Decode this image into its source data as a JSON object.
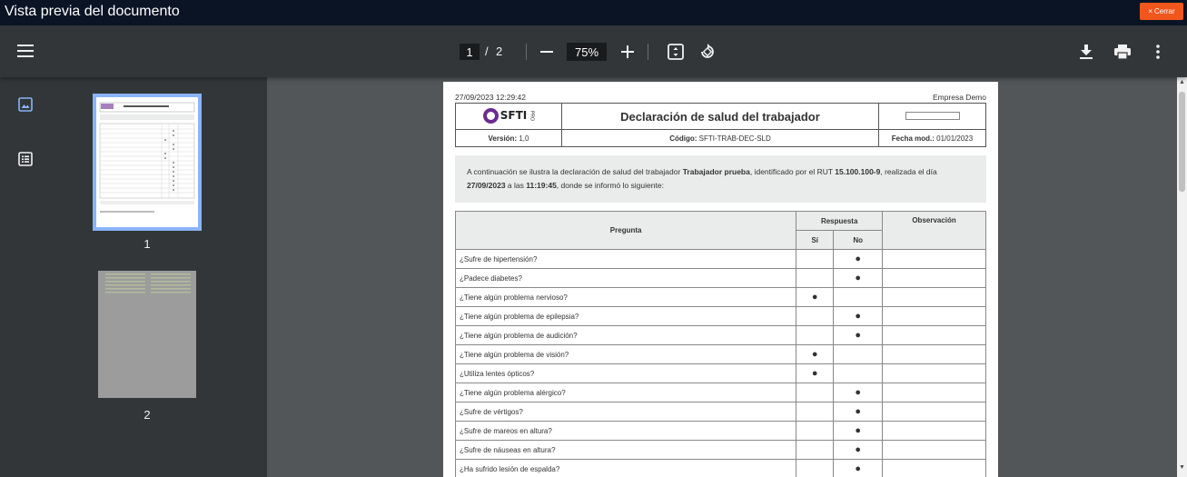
{
  "window": {
    "title": "Vista previa del documento",
    "close_label": "Cerrar",
    "close_symbol": "×"
  },
  "toolbar": {
    "menu_icon": "hamburger-menu-icon",
    "current_page": "1",
    "page_separator": "/",
    "total_pages": "2",
    "zoom_out_icon": "minus-icon",
    "zoom_level": "75%",
    "zoom_in_icon": "plus-icon",
    "fit_icon": "fit-to-page-icon",
    "rotate_icon": "rotate-counterclockwise-icon",
    "download_icon": "download-icon",
    "print_icon": "print-icon",
    "more_icon": "more-vertical-icon"
  },
  "sidebar": {
    "thumbnails_icon": "image-icon",
    "outline_icon": "list-icon",
    "pages": [
      {
        "label": "1",
        "selected": true
      },
      {
        "label": "2",
        "selected": false
      }
    ]
  },
  "document": {
    "timestamp": "27/09/2023 12:29:42",
    "company": "Empresa Demo",
    "logo_text": "SFTI",
    "logo_sub": "PRO",
    "title": "Declaración de salud del trabajador",
    "version_label": "Versión:",
    "version_value": "1,0",
    "code_label": "Código:",
    "code_value": "SFTI-TRAB-DEC-SLD",
    "date_mod_label": "Fecha mod.:",
    "date_mod_value": "01/01/2023",
    "intro": {
      "part1": "A continuación se ilustra la declaración de salud del trabajador ",
      "worker": "Trabajador prueba",
      "part2": ", identificado por el RUT ",
      "rut": "15.100.100-9",
      "part3": ", realizada el día ",
      "date": "27/09/2023",
      "part4": " a las ",
      "time": "11:19:45",
      "part5": ", donde se informó lo siguiente:"
    },
    "table": {
      "col_question": "Pregunta",
      "col_answer": "Respuesta",
      "col_yes": "Sí",
      "col_no": "No",
      "col_observation": "Observación",
      "mark": "●",
      "rows": [
        {
          "question": "¿Sufre de hipertensión?",
          "yes": "",
          "no": "●",
          "obs": ""
        },
        {
          "question": "¿Padece diabetes?",
          "yes": "",
          "no": "●",
          "obs": ""
        },
        {
          "question": "¿Tiene algún problema nervioso?",
          "yes": "●",
          "no": "",
          "obs": ""
        },
        {
          "question": "¿Tiene algún problema de epilepsia?",
          "yes": "",
          "no": "●",
          "obs": ""
        },
        {
          "question": "¿Tiene algún problema de audición?",
          "yes": "",
          "no": "●",
          "obs": ""
        },
        {
          "question": "¿Tiene algún problema de visión?",
          "yes": "●",
          "no": "",
          "obs": ""
        },
        {
          "question": "¿Utiliza lentes ópticos?",
          "yes": "●",
          "no": "",
          "obs": ""
        },
        {
          "question": "¿Tiene algún problema alérgico?",
          "yes": "",
          "no": "●",
          "obs": ""
        },
        {
          "question": "¿Sufre de vértigos?",
          "yes": "",
          "no": "●",
          "obs": ""
        },
        {
          "question": "¿Sufre de mareos en altura?",
          "yes": "",
          "no": "●",
          "obs": ""
        },
        {
          "question": "¿Sufre de náuseas en altura?",
          "yes": "",
          "no": "●",
          "obs": ""
        },
        {
          "question": "¿Ha sufrido lesión de espalda?",
          "yes": "",
          "no": "●",
          "obs": ""
        }
      ]
    }
  },
  "colors": {
    "titlebar_bg": "#0b1425",
    "close_button": "#f1561c",
    "toolbar_bg": "#323639",
    "viewer_bg": "#525659",
    "thumb_selected": "#8ab4f8",
    "logo_purple": "#6b2c91"
  }
}
